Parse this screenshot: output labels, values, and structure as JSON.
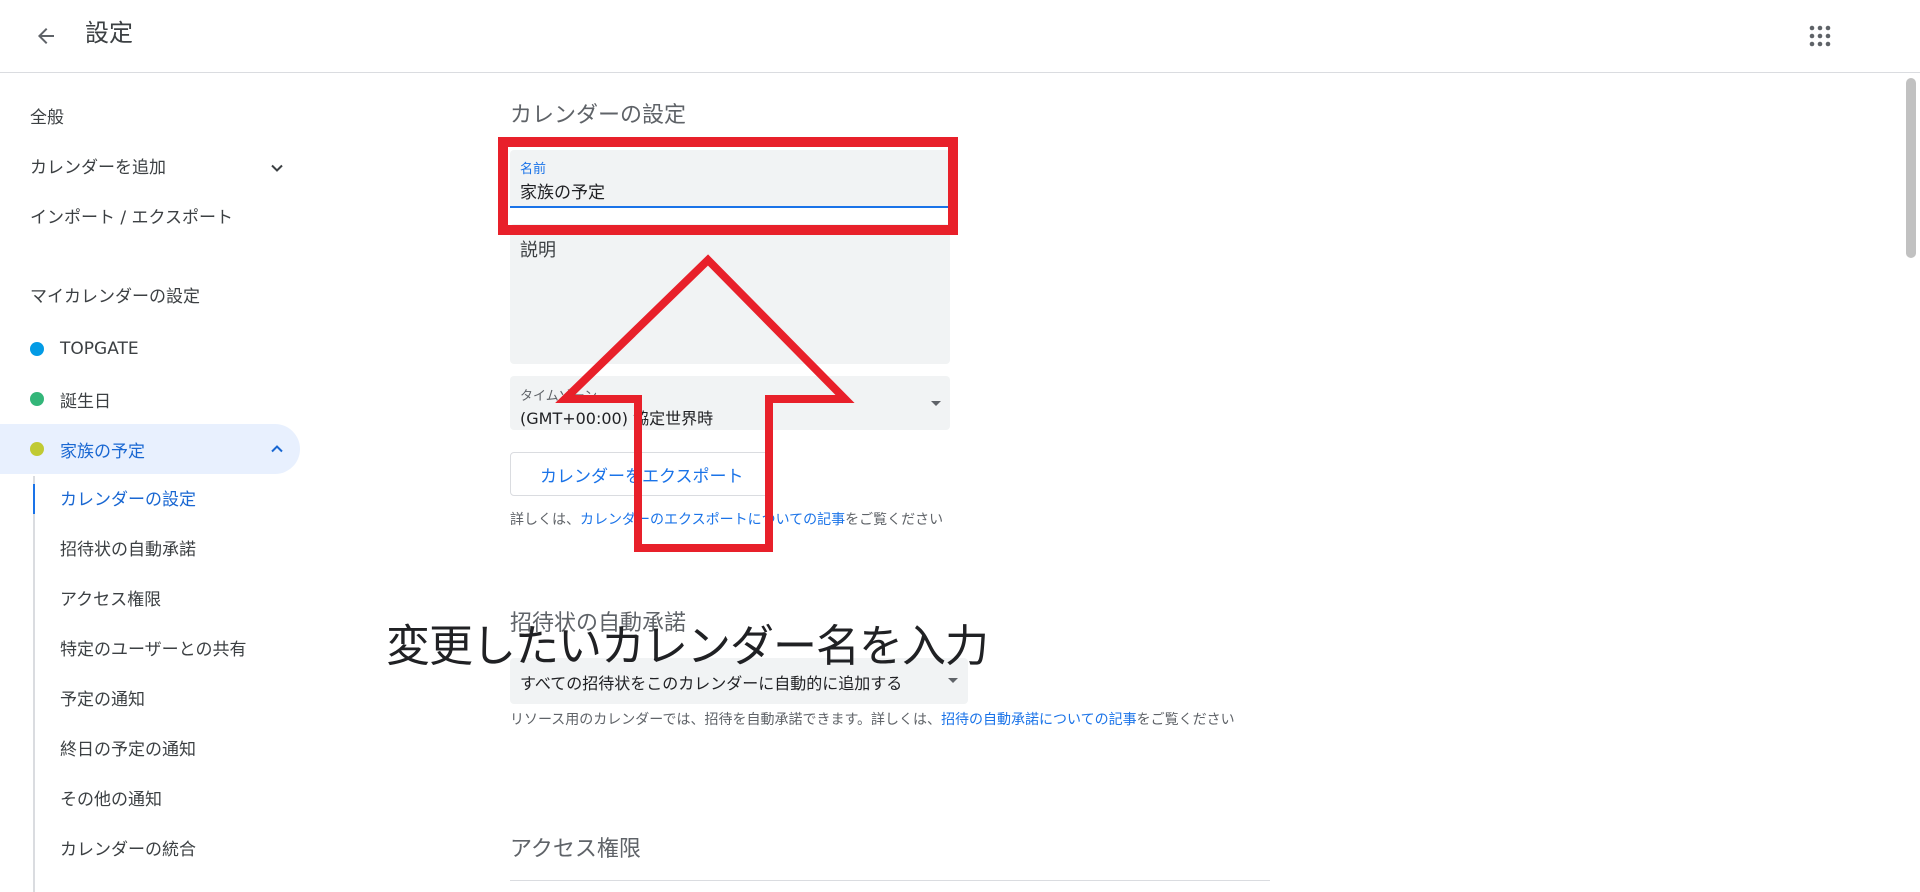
{
  "header": {
    "title": "設定"
  },
  "sidebar": {
    "general": "全般",
    "add_calendar": "カレンダーを追加",
    "import_export": "インポート / エクスポート",
    "my_calendars_heading": "マイカレンダーの設定",
    "calendars": [
      {
        "label": "TOPGATE",
        "color": "#039be5"
      },
      {
        "label": "誕生日",
        "color": "#33b679"
      },
      {
        "label": "家族の予定",
        "color": "#c0ca33"
      }
    ],
    "sub_items": [
      "カレンダーの設定",
      "招待状の自動承諾",
      "アクセス権限",
      "特定のユーザーとの共有",
      "予定の通知",
      "終日の予定の通知",
      "その他の通知",
      "カレンダーの統合"
    ]
  },
  "main": {
    "calendar_settings_title": "カレンダーの設定",
    "name_label": "名前",
    "name_value": "家族の予定",
    "description_placeholder": "説明",
    "timezone_label": "タイムゾーン",
    "timezone_value": "(GMT+00:00) 協定世界時",
    "export_button": "カレンダーをエクスポート",
    "export_help_prefix": "詳しくは、",
    "export_help_link": "カレンダーのエクスポートについての記事",
    "export_help_suffix": "をご覧ください",
    "auto_accept_title": "招待状の自動承諾",
    "auto_accept_value": "すべての招待状をこのカレンダーに自動的に追加する",
    "auto_accept_help_prefix": "リソース用のカレンダーでは、招待を自動承諾できます。詳しくは、",
    "auto_accept_help_link": "招待の自動承諾についての記事",
    "auto_accept_help_suffix": "をご覧ください",
    "access_title": "アクセス権限"
  },
  "annotation": {
    "text": "変更したいカレンダー名を入力",
    "highlight_color": "#e8202a"
  }
}
